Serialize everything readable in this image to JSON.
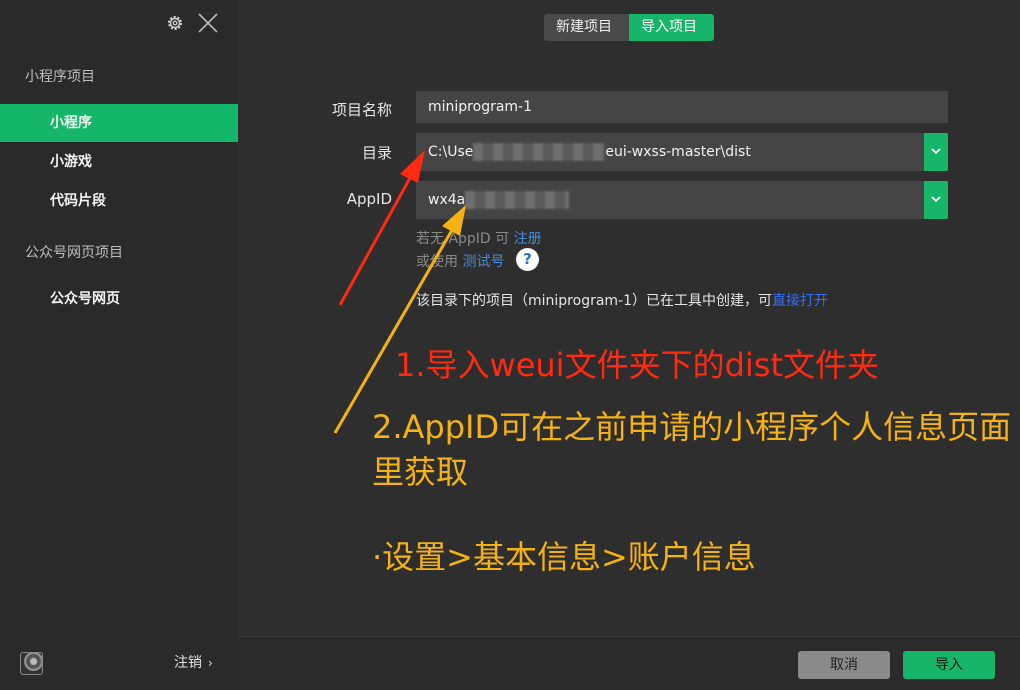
{
  "sidebar": {
    "section_mini": "小程序项目",
    "items": [
      {
        "label": "小程序",
        "active": true
      },
      {
        "label": "小游戏",
        "active": false
      },
      {
        "label": "代码片段",
        "active": false
      }
    ],
    "section_web": "公众号网页项目",
    "web_item": "公众号网页",
    "logout_label": "注销",
    "logout_chevron": "›"
  },
  "header": {
    "tabs": [
      {
        "label": "新建项目",
        "active": false
      },
      {
        "label": "导入项目",
        "active": true
      }
    ]
  },
  "form": {
    "name_label": "项目名称",
    "name_value": "miniprogram-1",
    "dir_label": "目录",
    "dir_value_start": "C:\\Use",
    "dir_value_end": "eui-wxss-master\\dist",
    "appid_label": "AppID",
    "appid_value": "wx4a",
    "hint_line1_prefix": "若无 AppID 可",
    "hint_line1_link": "注册",
    "hint_line2_prefix": "或使用",
    "hint_line2_link": "测试号",
    "help_icon_text": "?",
    "note_prefix": "该目录下的项目（miniprogram-1）已在工具中创建，可",
    "note_link": "直接打开"
  },
  "annotations": {
    "step1": "1.导入weui文件夹下的dist文件夹",
    "step2": "2.AppID可在之前申请的小程序个人信息页面里获取",
    "step3": "·设置>基本信息>账户信息",
    "colors": {
      "step1": "#ff2a12",
      "step2": "#f5b213"
    }
  },
  "footer": {
    "cancel_label": "取消",
    "import_label": "导入"
  },
  "colors": {
    "accent": "#16b56a",
    "sidebar_bg": "#2a2a2a",
    "main_bg": "#2e2e2e",
    "link": "#4a89d6"
  }
}
